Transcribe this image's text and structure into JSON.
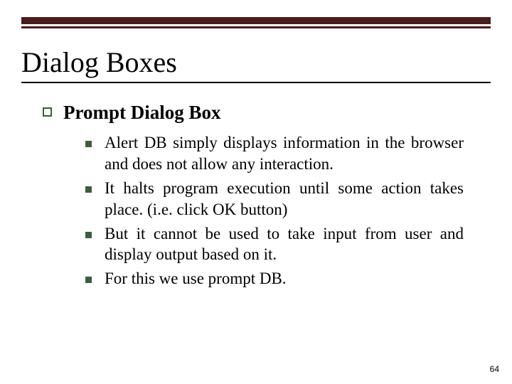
{
  "title": "Dialog Boxes",
  "subtitle": "Prompt Dialog Box",
  "bullets": [
    "Alert DB simply displays information in the browser and does not allow any interaction.",
    "It halts program execution until some action takes place. (i.e. click OK button)",
    "But it cannot be used to take input from user and display output based on it.",
    "For this we use prompt DB."
  ],
  "page_number": "64"
}
